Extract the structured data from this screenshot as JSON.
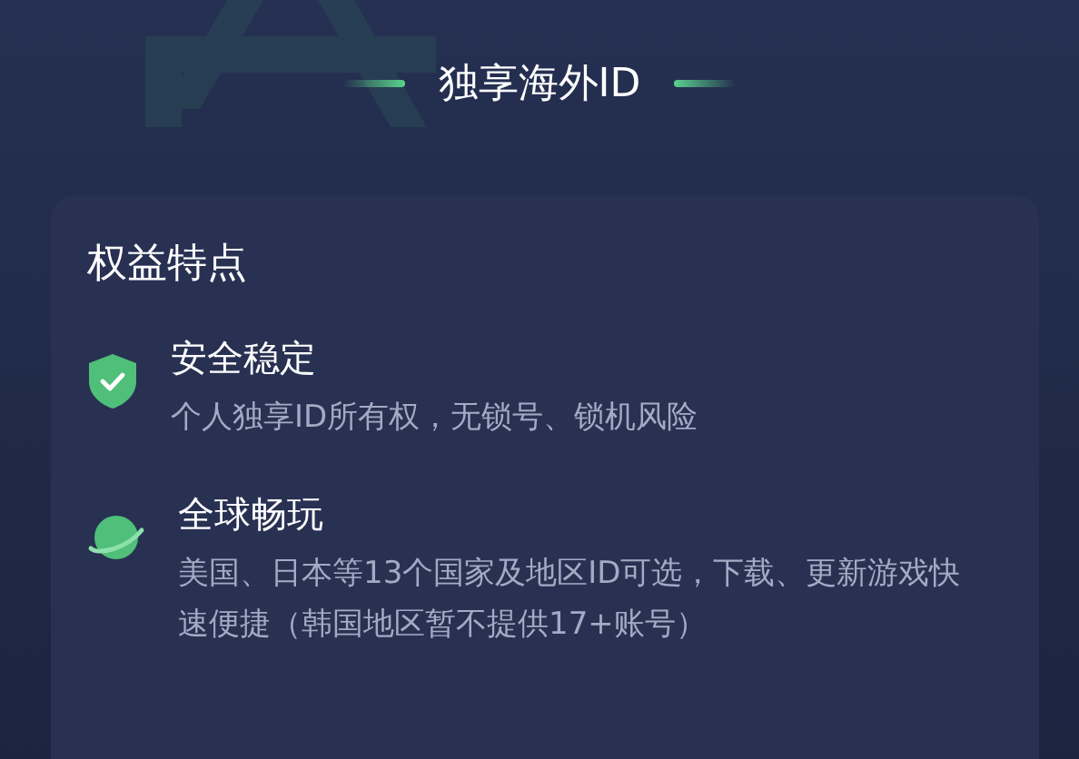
{
  "header": {
    "title": "独享海外ID"
  },
  "card": {
    "heading": "权益特点",
    "features": [
      {
        "kind": "shield",
        "title": "安全稳定",
        "description": "个人独享ID所有权，无锁号、锁机风险"
      },
      {
        "kind": "planet",
        "title": "全球畅玩",
        "description": "美国、日本等13个国家及地区ID可选，下载、更新游戏快速便捷（韩国地区暂不提供17+账号）"
      }
    ]
  }
}
